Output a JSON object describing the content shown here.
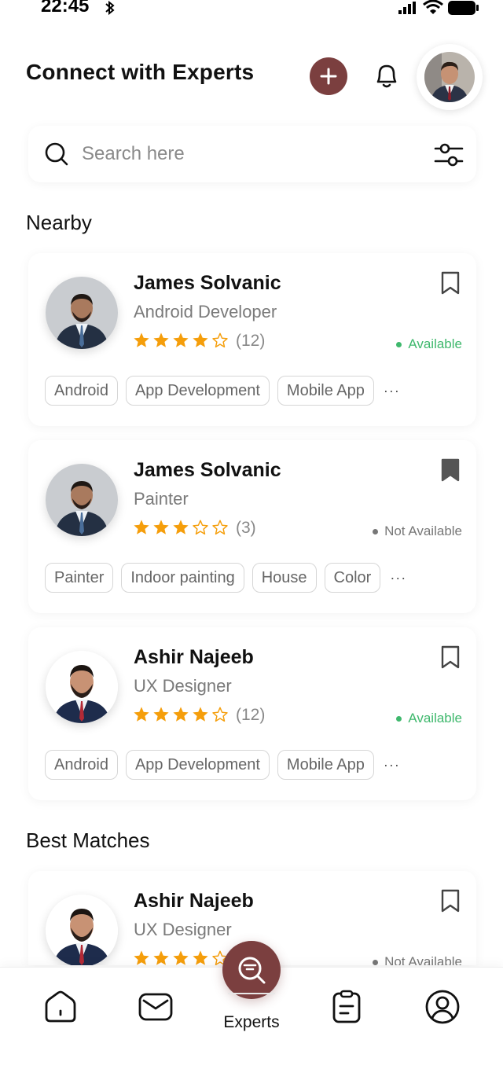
{
  "status_bar": {
    "time": "22:45"
  },
  "header": {
    "title": "Connect with Experts"
  },
  "search": {
    "placeholder": "Search here"
  },
  "sections": {
    "nearby": "Nearby",
    "best_matches": "Best Matches"
  },
  "colors": {
    "accent": "#7b3f3f",
    "available": "#3fb86d",
    "star": "#f59e0b"
  },
  "nearby_cards": [
    {
      "name": "James Solvanic",
      "role": "Android Developer",
      "rating": 4,
      "rating_count": "(12)",
      "status": "Available",
      "bookmarked": false,
      "tags": [
        "Android",
        "App Development",
        "Mobile App"
      ],
      "more": "···"
    },
    {
      "name": "James Solvanic",
      "role": "Painter",
      "rating": 3,
      "rating_count": "(3)",
      "status": "Not Available",
      "bookmarked": true,
      "tags": [
        "Painter",
        "Indoor painting",
        "House",
        "Color"
      ],
      "more": "···"
    },
    {
      "name": "Ashir Najeeb",
      "role": "UX Designer",
      "rating": 4,
      "rating_count": "(12)",
      "status": "Available",
      "bookmarked": false,
      "tags": [
        "Android",
        "App Development",
        "Mobile App"
      ],
      "more": "···"
    }
  ],
  "best_match_cards": [
    {
      "name": "Ashir Najeeb",
      "role": "UX Designer",
      "rating": 4,
      "status": "Not Available",
      "bookmarked": false
    }
  ],
  "bottom_nav": {
    "items": [
      "home-icon",
      "mail-icon",
      "experts-icon",
      "clipboard-icon",
      "user-icon"
    ],
    "active_label": "Experts"
  }
}
